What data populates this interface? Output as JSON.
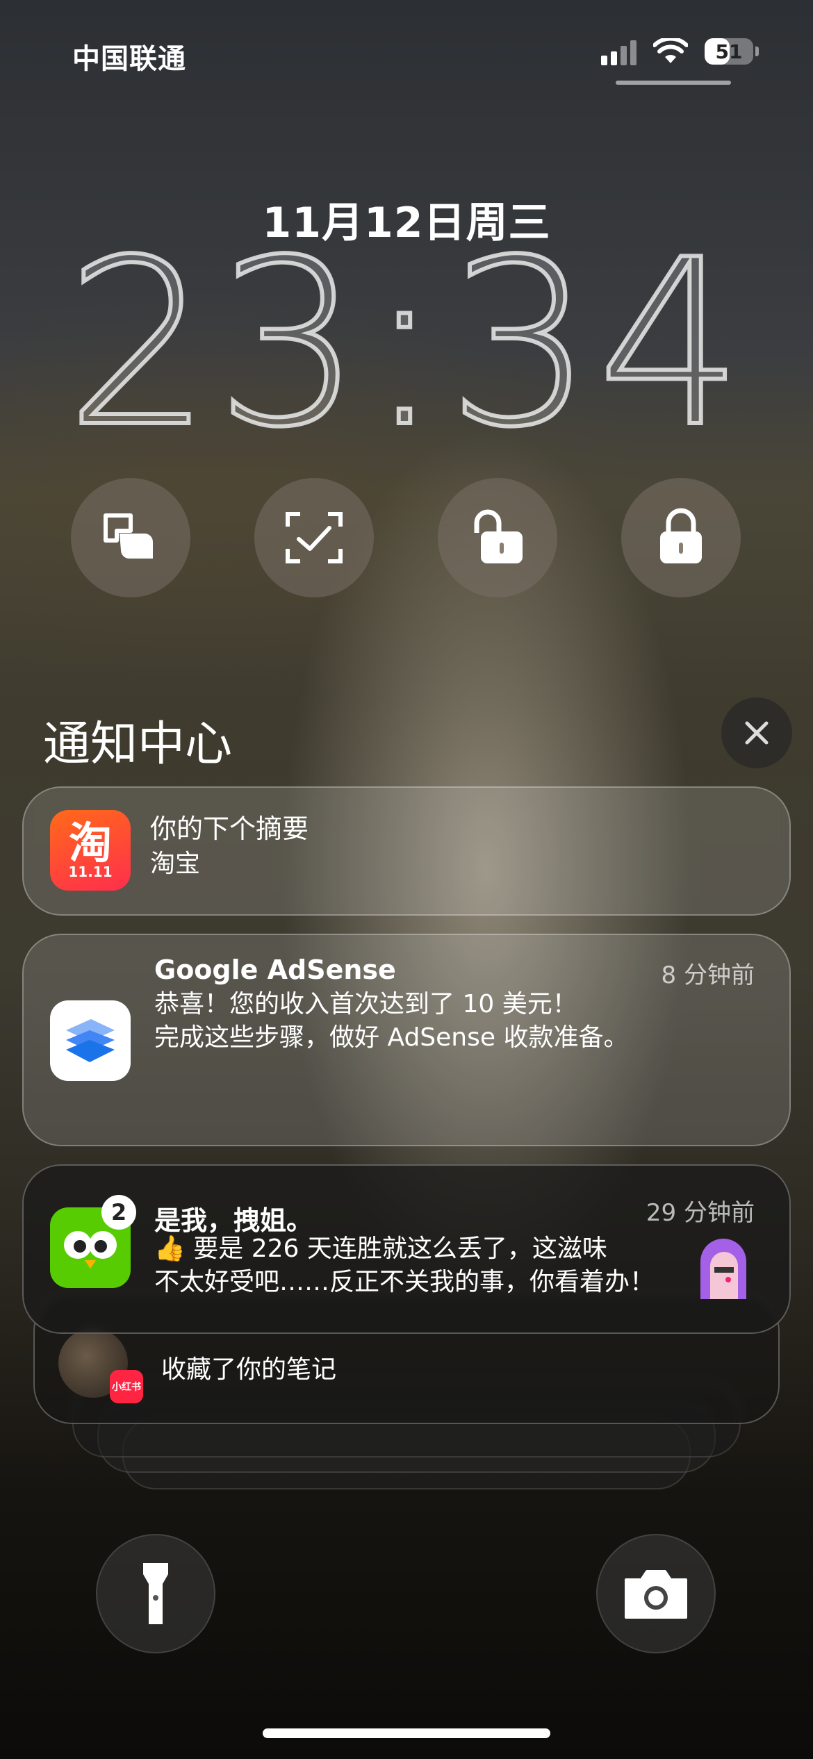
{
  "status_bar": {
    "carrier": "中国联通",
    "battery_percent": "51",
    "battery_level": 0.51,
    "signal_bars_active": 2,
    "icons": [
      "signal-icon",
      "wifi-icon",
      "battery-icon"
    ]
  },
  "lock_screen": {
    "date": "11月12日周三",
    "time": "23:34"
  },
  "quick_actions": [
    {
      "name": "split-screen-icon"
    },
    {
      "name": "scan-check-icon"
    },
    {
      "name": "unlock-icon"
    },
    {
      "name": "lock-icon"
    }
  ],
  "notification_center": {
    "title": "通知中心",
    "notifications": [
      {
        "app": "taobao",
        "title": "你的下个摘要",
        "body": "淘宝",
        "icon_text": "淘",
        "icon_sub": "11.11"
      },
      {
        "app": "google-adsense",
        "title": "Google AdSense",
        "time": "8 分钟前",
        "body_line1": "恭喜！您的收入首次达到了 10 美元！",
        "body_line2": "完成这些步骤，做好 AdSense 收款准备。"
      },
      {
        "app": "duolingo",
        "badge": "2",
        "title": "是我，拽姐。",
        "time": "29 分钟前",
        "body_line1": "👍 要是 226 天连胜就这么丢了，这滋味",
        "body_line2": "不太好受吧……反正不关我的事，你看着办！"
      },
      {
        "app": "xiaohongshu",
        "badge_text": "小红书",
        "body": "收藏了你的笔记"
      }
    ]
  },
  "bottom_buttons": [
    {
      "name": "flashlight-icon"
    },
    {
      "name": "camera-icon"
    }
  ],
  "colors": {
    "taobao": "#ff5000",
    "adsense": "#4285f4",
    "duolingo": "#58cc02",
    "xiaohongshu": "#ff2442"
  }
}
